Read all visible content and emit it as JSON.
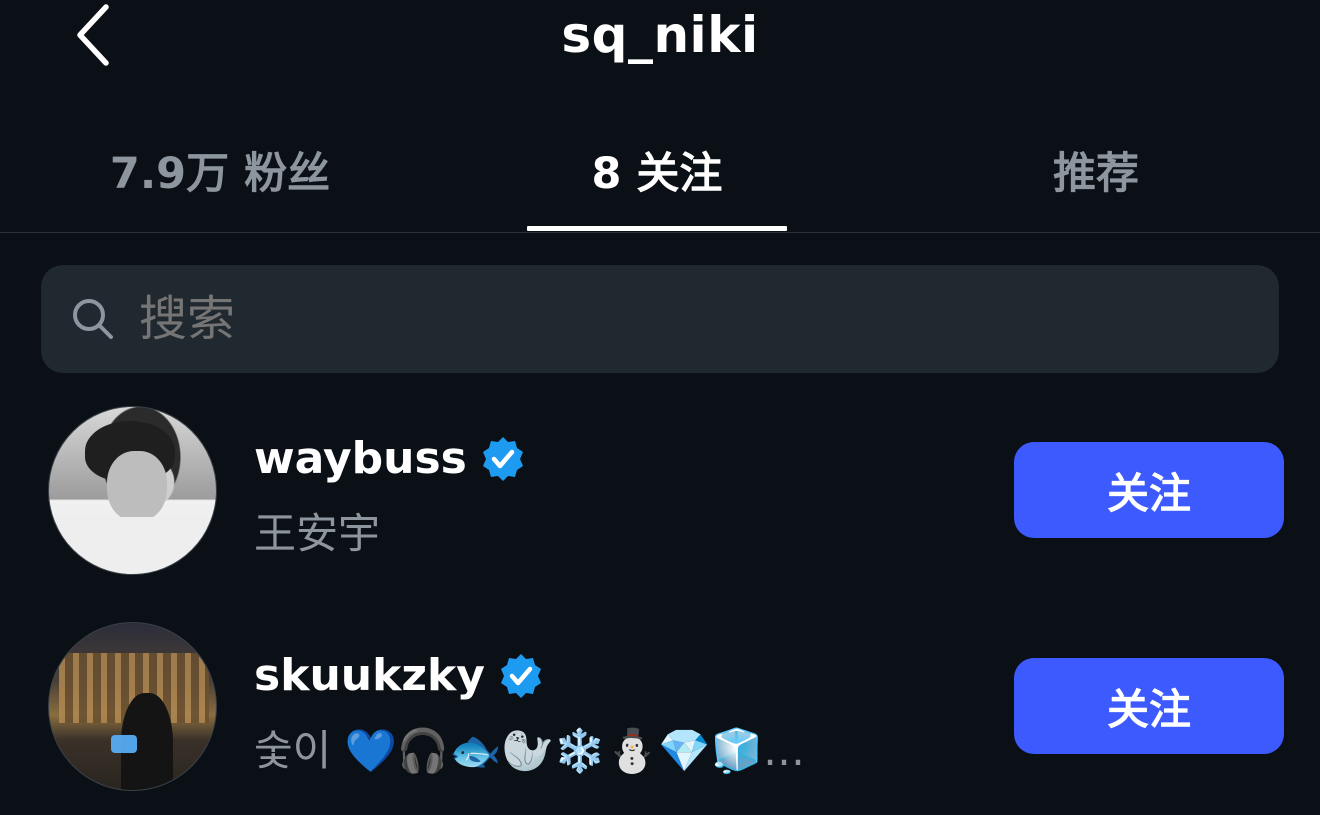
{
  "header": {
    "title": "sq_niki"
  },
  "tabs": [
    {
      "label": "7.9万 粉丝",
      "active": false
    },
    {
      "label": "8 关注",
      "active": true
    },
    {
      "label": "推荐",
      "active": false
    }
  ],
  "search": {
    "placeholder": "搜索"
  },
  "users": [
    {
      "username": "waybuss",
      "verified": true,
      "subtitle": "王安宇",
      "button_label": "关注"
    },
    {
      "username": "skuukzky",
      "verified": true,
      "subtitle": "숯이  💙🎧🐟🦭❄️⛄💎🧊…",
      "button_label": "关注"
    }
  ],
  "colors": {
    "background": "#0b1016",
    "accent": "#3d5afe",
    "verified": "#1d9bf0",
    "muted_text": "#8d969e",
    "search_bg": "#202830"
  }
}
